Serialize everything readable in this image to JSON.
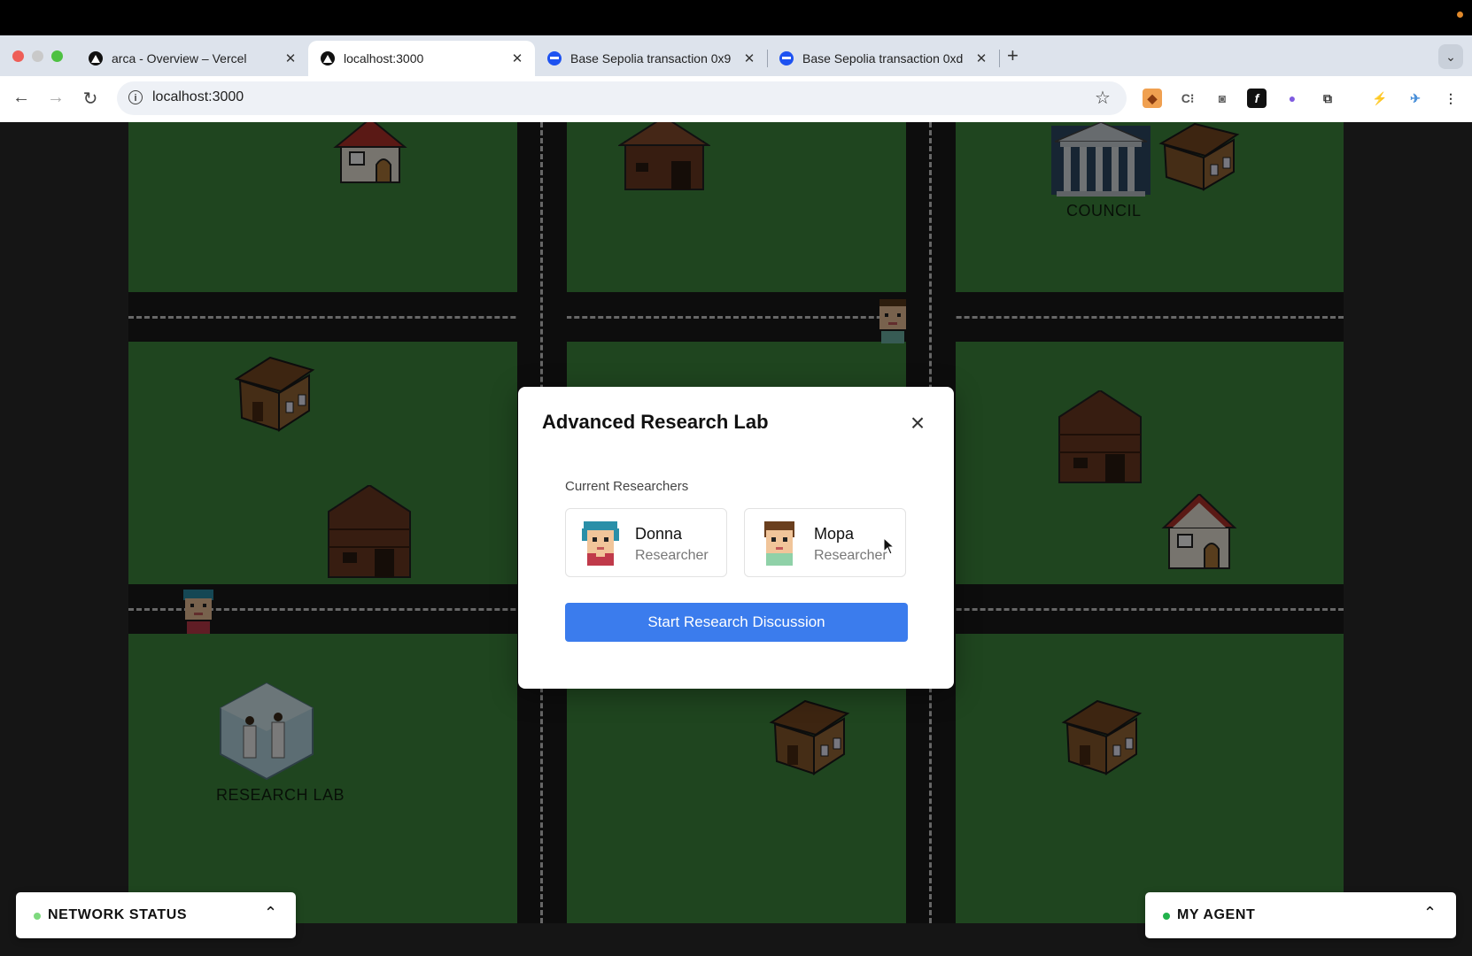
{
  "browser": {
    "tabs": [
      {
        "title": "arca - Overview – Vercel",
        "favicon": "vercel-icon"
      },
      {
        "title": "localhost:3000",
        "favicon": "vercel-icon",
        "active": true
      },
      {
        "title": "Base Sepolia transaction 0x9",
        "favicon": "base-icon"
      },
      {
        "title": "Base Sepolia transaction 0xd",
        "favicon": "base-icon"
      }
    ],
    "url": "localhost:3000",
    "new_tab": "+",
    "tab_menu": "⌄"
  },
  "map": {
    "council_label": "COUNCIL",
    "research_lab_label": "RESEARCH LAB"
  },
  "modal": {
    "title": "Advanced Research Lab",
    "close": "×",
    "section_label": "Current Researchers",
    "researchers": [
      {
        "name": "Donna",
        "role": "Researcher"
      },
      {
        "name": "Mopa",
        "role": "Researcher"
      }
    ],
    "start_button": "Start Research Discussion"
  },
  "panels": {
    "network": {
      "title": "NETWORK STATUS",
      "status_color": "#7ed97e",
      "chevron": "⌃"
    },
    "agent": {
      "title": "MY AGENT",
      "status_color": "#22b24c",
      "chevron": "⌃"
    }
  },
  "colors": {
    "grass": "#3f8a3e",
    "road": "#1b1b1b",
    "accent": "#3b7ced"
  }
}
